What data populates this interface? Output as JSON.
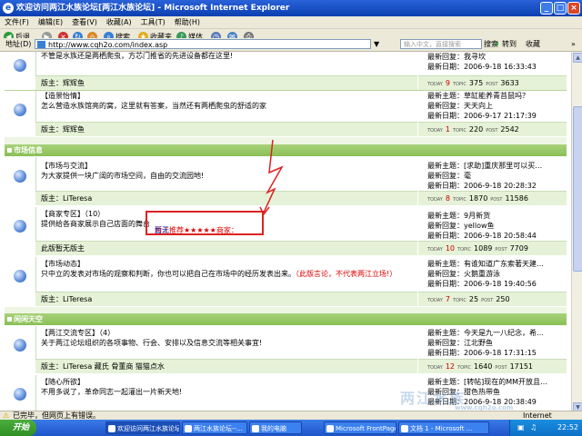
{
  "window": {
    "title": "欢迎访问两江水族论坛[两江水族论坛] - Microsoft Internet Explorer",
    "min": "_",
    "max": "□",
    "close": "×"
  },
  "menu": [
    "文件(F)",
    "编辑(E)",
    "查看(V)",
    "收藏(A)",
    "工具(T)",
    "帮助(H)"
  ],
  "toolbar": {
    "back": "后退",
    "search": "搜索",
    "favorites": "收藏夹",
    "media": "媒体"
  },
  "address": {
    "label": "地址(D)",
    "url": "http://www.cqh2o.com/index.asp",
    "search_placeholder": "输入中文，直接搜索",
    "search_btn": "搜索",
    "go": "转到",
    "fav": "收藏",
    "links": "»"
  },
  "top_partial": {
    "desc": "不管是水族还是两栖爬虫，方芯门推省的先进设备都在这里!",
    "last_author": "最新回复：我寻坎",
    "last_date": "最新日期：2006-9-18 16:33:43",
    "mod": "版主：辉辉鱼",
    "today": "9",
    "topic": "375",
    "post": "3633"
  },
  "forums": [
    {
      "title": "【造景怡情】",
      "desc": "怎么营造水族馆亮的窝，这里就有答案，当然还有两栖爬虫的舒适的家",
      "last_topic": "最新主题：草缸能养青苔鼠吗？",
      "last_author": "最新回复：天天向上",
      "last_date": "最新日期：2006-9-17 21:17:39",
      "mod": "版主：辉辉鱼",
      "today": "1",
      "topic": "220",
      "post": "2542"
    }
  ],
  "sections": [
    {
      "name": "市场信息"
    },
    {
      "name": "闲闲天空"
    }
  ],
  "market": [
    {
      "title": "【市场与交流】",
      "desc": "为大家提供一块广阔的市场空间，自由的交流园地!",
      "last_topic": "最新主题：[求助]重庆那里可以买…",
      "last_author": "最新回复：毫",
      "last_date": "最新日期：2006-9-18 20:28:32",
      "mod": "版主：LiTeresa",
      "today": "8",
      "topic": "1870",
      "post": "11586"
    },
    {
      "title": "【商家专区】（10）",
      "desc": "提供给各商家展示自己店面的舞台",
      "last_topic": "最新主题：9月新货",
      "last_author": "最新回复：yellow鱼",
      "last_date": "最新日期：2006-9-18 20:58:44",
      "mod": "此版暂无版主",
      "today": "10",
      "topic": "1089",
      "post": "7709"
    },
    {
      "title": "【市场动态】",
      "desc": "只中立的发表对市场的观察和判断，你也可以把自己在市场中的经历发表出来。",
      "desc_red": "（此版言论，不代表两江立场!）",
      "last_topic": "最新主题：有谁知道广东索著天建…",
      "last_author": "最新回复：火鹅重游泳",
      "last_date": "最新日期：2006-9-18 19:40:56",
      "mod": "版主：LiTeresa",
      "today": "7",
      "topic": "25",
      "post": "250"
    }
  ],
  "leisure": [
    {
      "title": "【两江交流专区】（4）",
      "desc": "关于两江论坛组织的各项事物、行会、安排以及信息交流等相关事宜!",
      "last_topic": "最新主题：今天是九一八纪念，希…",
      "last_author": "最新回复：江北野鱼",
      "last_date": "最新日期：2006-9-18 17:31:15",
      "mod": "版主：LiTeresa 藏氏 骨董商 猫猫点水",
      "today": "12",
      "topic": "1640",
      "post": "17151"
    },
    {
      "title": "【随心所欲】",
      "desc": "不用多说了，革命同志一起灌出一片新天地!",
      "last_topic": "最新主题：[转帖]现在的MM开放且…",
      "last_author": "最新回复：甜色热带鱼",
      "last_date": "最新日期：2006-9-18 20:38:49"
    }
  ],
  "callout": {
    "text_red": "两江推荐★★★★★商家：",
    "text_blue": "暂无"
  },
  "stat_labels": {
    "today": "TODAY",
    "topic": "TOPIC",
    "post": "POST"
  },
  "status": {
    "text": "已完毕，但网页上有错误。",
    "zone": "Internet"
  },
  "taskbar": {
    "start": "开始",
    "tasks": [
      "欢迎访问两江水族论坛...",
      "两江水族论坛--...",
      "我的电脑",
      "Microsoft FrontPage",
      "文档 1 - Microsoft ..."
    ],
    "clock": "22:52"
  },
  "watermark": {
    "main": "两江水族",
    "sub": "www.cqh2o.com"
  },
  "colors": {
    "section_green": "#8abf55",
    "row_green": "#e6f2d7",
    "title_blue": "#0a3fb0",
    "callout_red": "#d22"
  }
}
